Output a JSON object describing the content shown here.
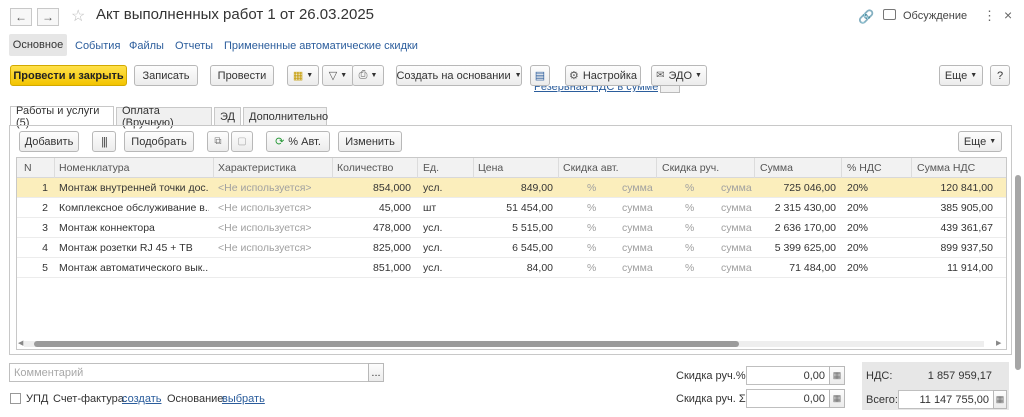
{
  "window": {
    "title": "Акт выполненных работ 1 от 26.03.2025",
    "discussion_label": "Обсуждение",
    "menu_icon": "more-vertical-icon",
    "close_icon": "close-icon"
  },
  "nav": {
    "back_icon": "arrow-left-icon",
    "forward_icon": "arrow-right-icon",
    "star_icon": "star-icon",
    "link_icon": "link-icon"
  },
  "sections": [
    "Основное",
    "События",
    "Файлы",
    "Отчеты",
    "Примененные автоматические скидки"
  ],
  "toolbar": {
    "post_close": "Провести и закрыть",
    "save": "Записать",
    "post": "Провести",
    "create_based": "Создать на основании",
    "settings": "Настройка",
    "edo": "ЭДО",
    "more": "Еще",
    "help": "?"
  },
  "hidden_link": "Резервная НДС в сумме",
  "page_tabs": [
    "Работы и услуги (5)",
    "Оплата (Вручную)",
    "ЭД",
    "Дополнительно"
  ],
  "table_toolbar": {
    "add": "Добавить",
    "select": "Подобрать",
    "auto_percent": "% Авт.",
    "change": "Изменить",
    "more": "Еще"
  },
  "table": {
    "columns": [
      "N",
      "Номенклатура",
      "Характеристика",
      "Количество",
      "Ед.",
      "Цена",
      "Скидка авт.",
      "Скидка руч.",
      "Сумма",
      "% НДС",
      "Сумма НДС"
    ],
    "discount_percent": "%",
    "discount_sum": "сумма",
    "rows": [
      {
        "n": "1",
        "item": "Монтаж внутренней точки дос...",
        "char": "<Не используется>",
        "qty": "854,000",
        "unit": "усл.",
        "price": "849,00",
        "sum": "725 046,00",
        "vat": "20%",
        "vat_sum": "120 841,00"
      },
      {
        "n": "2",
        "item": "Комплексное обслуживание в...",
        "char": "<Не используется>",
        "qty": "45,000",
        "unit": "шт",
        "price": "51 454,00",
        "sum": "2 315 430,00",
        "vat": "20%",
        "vat_sum": "385 905,00"
      },
      {
        "n": "3",
        "item": "Монтаж коннектора",
        "char": "<Не используется>",
        "qty": "478,000",
        "unit": "усл.",
        "price": "5 515,00",
        "sum": "2 636 170,00",
        "vat": "20%",
        "vat_sum": "439 361,67"
      },
      {
        "n": "4",
        "item": "Монтаж розетки RJ 45 + ТВ",
        "char": "<Не используется>",
        "qty": "825,000",
        "unit": "усл.",
        "price": "6 545,00",
        "sum": "5 399 625,00",
        "vat": "20%",
        "vat_sum": "899 937,50"
      },
      {
        "n": "5",
        "item": "Монтаж автоматического вык...",
        "char": "",
        "qty": "851,000",
        "unit": "усл.",
        "price": "84,00",
        "sum": "71 484,00",
        "vat": "20%",
        "vat_sum": "11 914,00"
      }
    ]
  },
  "footer": {
    "comment_placeholder": "Комментарий",
    "ellipsis": "...",
    "upd_label": "УПД",
    "invoice_label": "Счет-фактура:",
    "invoice_link": "создать",
    "basis_label": "Основание:",
    "basis_link": "выбрать",
    "manual_pct_label": "Скидка руч.%:",
    "manual_pct_value": "0,00",
    "manual_sum_label": "Скидка руч. Σ:",
    "manual_sum_value": "0,00",
    "vat_label": "НДС:",
    "vat_value": "1 857 959,17",
    "total_label": "Всего:",
    "total_value": "11 147 755,00"
  },
  "colors": {
    "accent": "#f3c400",
    "selected_row": "#fbeebc",
    "link": "#2b5d9c"
  }
}
